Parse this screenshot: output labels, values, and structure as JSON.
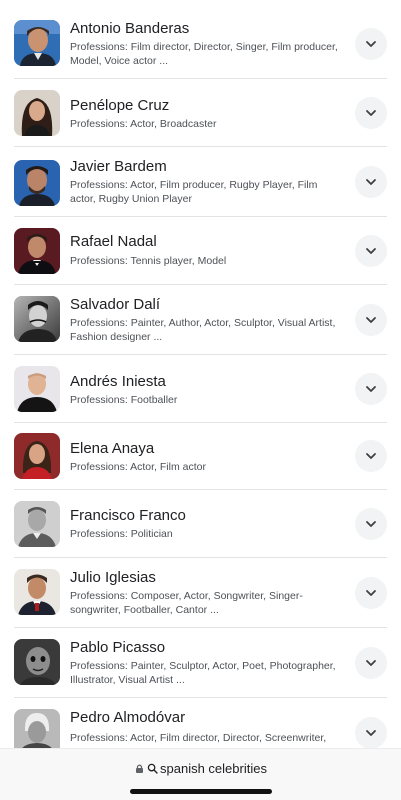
{
  "people": [
    {
      "name": "Antonio Banderas",
      "professions": "Professions: Film director, Director, Singer, Film producer, Model, Voice actor ...",
      "icon": "portrait-antonio-banderas"
    },
    {
      "name": "Penélope Cruz",
      "professions": "Professions: Actor, Broadcaster",
      "icon": "portrait-penelope-cruz"
    },
    {
      "name": "Javier Bardem",
      "professions": "Professions: Actor, Film producer, Rugby Player, Film actor, Rugby Union Player",
      "icon": "portrait-javier-bardem"
    },
    {
      "name": "Rafael Nadal",
      "professions": "Professions: Tennis player, Model",
      "icon": "portrait-rafael-nadal"
    },
    {
      "name": "Salvador Dalí",
      "professions": "Professions: Painter, Author, Actor, Sculptor, Visual Artist, Fashion designer ...",
      "icon": "portrait-salvador-dali"
    },
    {
      "name": "Andrés Iniesta",
      "professions": "Professions: Footballer",
      "icon": "portrait-andres-iniesta"
    },
    {
      "name": "Elena Anaya",
      "professions": "Professions: Actor, Film actor",
      "icon": "portrait-elena-anaya"
    },
    {
      "name": "Francisco Franco",
      "professions": "Professions: Politician",
      "icon": "portrait-francisco-franco"
    },
    {
      "name": "Julio Iglesias",
      "professions": "Professions: Composer, Actor, Songwriter, Singer-songwriter, Footballer, Cantor ...",
      "icon": "portrait-julio-iglesias"
    },
    {
      "name": "Pablo Picasso",
      "professions": "Professions: Painter, Sculptor, Actor, Poet, Photographer, Illustrator, Visual Artist ...",
      "icon": "portrait-pablo-picasso"
    },
    {
      "name": "Pedro Almodóvar",
      "professions": "Professions: Actor, Film director, Director, Screenwriter,",
      "icon": "portrait-pedro-almodovar"
    }
  ],
  "address_bar": {
    "query": "spanish celebrities",
    "lock_icon": "lock-icon",
    "search_icon": "search-icon"
  },
  "colors": {
    "divider": "#e3e3e3",
    "chevron_bg": "#f1f3f4",
    "name_text": "#202124",
    "secondary_text": "#4d5156"
  }
}
